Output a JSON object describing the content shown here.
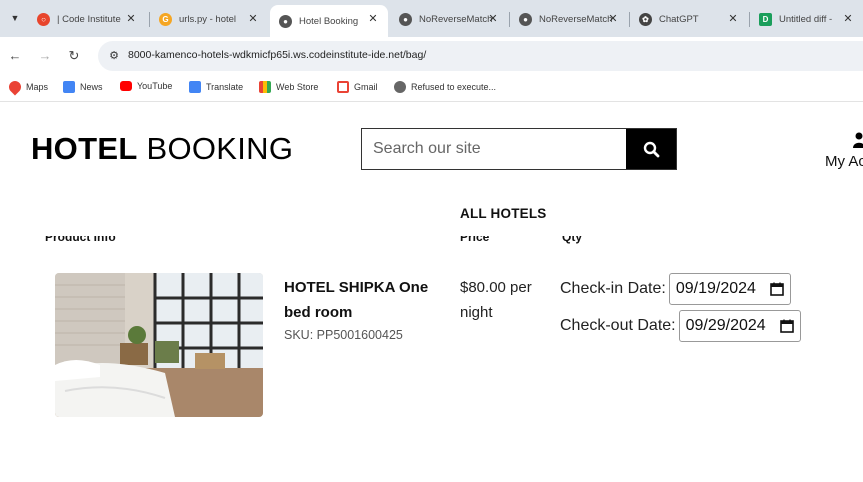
{
  "browser": {
    "tabs": [
      {
        "title": "| Code Institute",
        "favicon_color": "#e8452c"
      },
      {
        "title": "urls.py - hotel",
        "favicon_color": "#f5a623"
      },
      {
        "title": "Hotel Booking",
        "favicon_color": "#555555",
        "active": true
      },
      {
        "title": "NoReverseMatch",
        "favicon_color": "#555555"
      },
      {
        "title": "NoReverseMatch",
        "favicon_color": "#555555"
      },
      {
        "title": "ChatGPT",
        "favicon_color": "#444444"
      },
      {
        "title": "Untitled diff -",
        "favicon_color": "#1a9e5b"
      }
    ],
    "url": "8000-kamenco-hotels-wdkmicfp65i.ws.codeinstitute-ide.net/bag/",
    "bookmarks": [
      {
        "label": "Maps",
        "icon": "maps-pin-icon"
      },
      {
        "label": "News",
        "icon": "news-icon"
      },
      {
        "label": "YouTube",
        "icon": "youtube-icon"
      },
      {
        "label": "Translate",
        "icon": "translate-icon"
      },
      {
        "label": "Web Store",
        "icon": "web-store-icon"
      },
      {
        "label": "Gmail",
        "icon": "gmail-icon"
      },
      {
        "label": "Refused to execute...",
        "icon": "globe-icon"
      }
    ]
  },
  "header": {
    "logo_bold": "HOTEL",
    "logo_light": "BOOKING",
    "search_placeholder": "Search our site",
    "account_label": "My Account"
  },
  "nav": {
    "all_hotels": "ALL HOTELS"
  },
  "table": {
    "headers": [
      "Product Info",
      "Price",
      "Qty"
    ],
    "item": {
      "name": "HOTEL SHIPKA One bed room",
      "sku": "SKU: PP5001600425",
      "price": "$80.00 per night",
      "checkin_label": "Check-in Date:",
      "checkin_value": "09/19/2024",
      "checkout_label": "Check-out Date:",
      "checkout_value": "09/29/2024"
    }
  },
  "colors": {
    "accent": "#000000",
    "tabbar": "#dde3ea"
  }
}
